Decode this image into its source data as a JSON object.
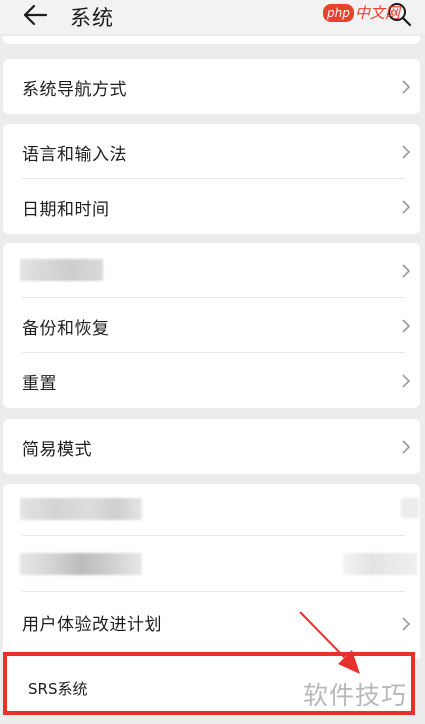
{
  "header": {
    "title": "系统",
    "back_icon": "arrow-left-icon",
    "search_icon": "search-icon"
  },
  "watermark_top": {
    "badge": "php",
    "text": "中文网"
  },
  "sections": [
    {
      "items": [
        {
          "label": "系统导航方式",
          "chevron": true
        }
      ]
    },
    {
      "items": [
        {
          "label": "语言和输入法",
          "chevron": true
        },
        {
          "label": "日期和时间",
          "chevron": true
        }
      ]
    },
    {
      "items": [
        {
          "label": "",
          "blurred": true,
          "chevron": true
        },
        {
          "label": "备份和恢复",
          "chevron": true
        },
        {
          "label": "重置",
          "chevron": true
        }
      ]
    },
    {
      "items": [
        {
          "label": "简易模式",
          "chevron": true
        }
      ]
    },
    {
      "items": [
        {
          "label": "",
          "blurred": true,
          "chevron": false
        },
        {
          "label": "",
          "blurred": true,
          "chevron": false
        },
        {
          "label": "用户体验改进计划",
          "chevron": true
        }
      ]
    }
  ],
  "highlighted_item": {
    "label": "SRS系统"
  },
  "annotation": {
    "color": "#e8312d"
  },
  "watermark_bottom": {
    "text": "软件技巧"
  }
}
